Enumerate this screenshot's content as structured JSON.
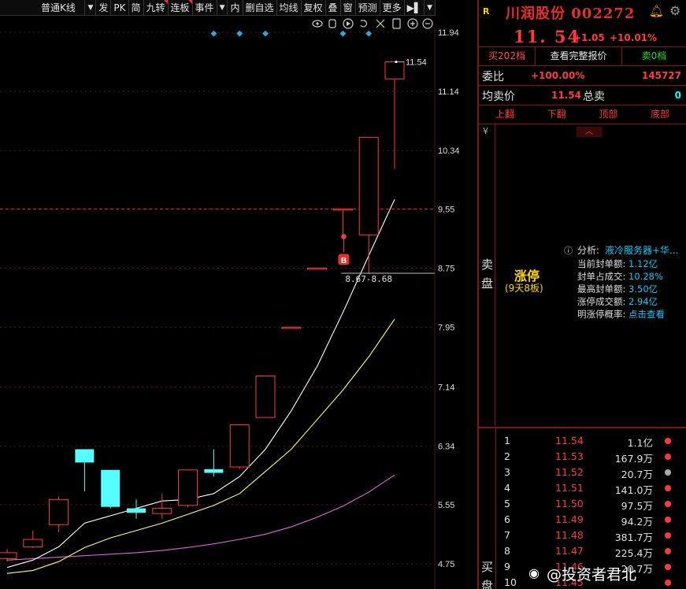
{
  "toolbar": {
    "items": [
      "普通K线",
      "▼",
      "发",
      "PK",
      "简",
      "九转",
      "连板",
      "事件",
      "▼",
      "内",
      "删自选",
      "均线",
      "复权",
      "叠",
      "窗",
      "预测",
      "更多",
      "▶▌",
      "▼"
    ]
  },
  "chart": {
    "price_axis": [
      "11.94",
      "11.14",
      "10.34",
      "9.55",
      "8.75",
      "7.95",
      "7.14",
      "6.34",
      "5.55",
      "4.75"
    ],
    "limit_up_label": "11.54",
    "gap_label": "8.67-8.68",
    "buy_marker": "B",
    "ma_colors": {
      "ma5": "#ffffff",
      "ma10": "#ffff66",
      "ma20": "#dd66dd"
    },
    "up_color": "#ff3b3b",
    "down_color": "#55ffff",
    "candles": [
      {
        "o": 4.82,
        "c": 4.9,
        "h": 4.95,
        "l": 4.78
      },
      {
        "o": 4.98,
        "c": 5.08,
        "h": 5.2,
        "l": 4.96
      },
      {
        "o": 5.28,
        "c": 5.62,
        "h": 5.66,
        "l": 5.18
      },
      {
        "o": 6.3,
        "c": 6.12,
        "h": 6.3,
        "l": 5.73
      },
      {
        "o": 6.02,
        "c": 5.52,
        "h": 6.02,
        "l": 5.5
      },
      {
        "o": 5.5,
        "c": 5.44,
        "h": 5.62,
        "l": 5.36
      },
      {
        "o": 5.43,
        "c": 5.5,
        "h": 5.7,
        "l": 5.36
      },
      {
        "o": 5.54,
        "c": 6.02,
        "h": 6.02,
        "l": 5.52
      },
      {
        "o": 6.03,
        "c": 5.98,
        "h": 6.3,
        "l": 5.93
      },
      {
        "o": 6.06,
        "c": 6.63,
        "h": 6.63,
        "l": 6.03
      },
      {
        "o": 6.73,
        "c": 7.29,
        "h": 7.29,
        "l": 6.73
      },
      {
        "o": 7.95,
        "c": 7.95,
        "h": 7.95,
        "l": 7.95
      },
      {
        "o": 8.75,
        "c": 8.75,
        "h": 8.75,
        "l": 8.75
      },
      {
        "o": 9.55,
        "c": 9.55,
        "h": 9.55,
        "l": 9.2
      },
      {
        "o": 9.2,
        "c": 10.52,
        "h": 10.52,
        "l": 8.67
      },
      {
        "o": 11.31,
        "c": 11.54,
        "h": 11.54,
        "l": 10.09
      }
    ],
    "ma5": [
      4.7,
      4.8,
      4.98,
      5.3,
      5.4,
      5.5,
      5.6,
      5.62,
      5.7,
      5.93,
      6.3,
      6.82,
      7.42,
      8.15,
      8.92,
      9.68
    ],
    "ma10": [
      4.62,
      4.66,
      4.78,
      4.97,
      5.1,
      5.2,
      5.3,
      5.42,
      5.54,
      5.7,
      6.0,
      6.3,
      6.7,
      7.1,
      7.55,
      8.06
    ],
    "ma20": [
      4.8,
      4.82,
      4.84,
      4.86,
      4.88,
      4.9,
      4.93,
      4.97,
      5.02,
      5.08,
      5.15,
      5.25,
      5.38,
      5.53,
      5.72,
      5.95
    ]
  },
  "header": {
    "r_mark": "R",
    "stock_name": "川润股份 002272",
    "last_price": "11. 54",
    "change": "+1.05",
    "change_pct": "+10.01%"
  },
  "tabs": {
    "buy": "买202档",
    "quote": "查看完整报价",
    "sell": "卖0档"
  },
  "stats": {
    "wb_label": "委比",
    "wb_pct": "+100.00%",
    "wb_value": "145727",
    "avg_label": "均卖价",
    "avg_value": "11.54",
    "total_label": "总卖",
    "total_value": "0"
  },
  "nav": [
    "上翻",
    "下翻",
    "顶部",
    "底部"
  ],
  "sell_panel": {
    "yen": "¥",
    "vertical_label": "卖盘",
    "chevron": "︿",
    "limit_title": "涨停",
    "limit_sub": "(9天8板)",
    "analysis_label": "分析:",
    "analysis_value": "液冷服务器+华...",
    "rows": [
      {
        "k": "当前封单额:",
        "v": "1.12亿"
      },
      {
        "k": "封单占成交:",
        "v": "10.28%"
      },
      {
        "k": "最高封单额:",
        "v": "3.50亿"
      },
      {
        "k": "涨停成交额:",
        "v": "2.94亿"
      },
      {
        "k": "明涨停概率:",
        "v": "点击查看"
      }
    ]
  },
  "order_book": {
    "vertical_label": "买盘",
    "rows": [
      {
        "lv": "1",
        "px": "11.54",
        "vol": "1.1亿",
        "dot": "red"
      },
      {
        "lv": "2",
        "px": "11.53",
        "vol": "167.9万",
        "dot": "red"
      },
      {
        "lv": "3",
        "px": "11.52",
        "vol": "20.7万",
        "dot": "grey"
      },
      {
        "lv": "4",
        "px": "11.51",
        "vol": "141.0万",
        "dot": "red"
      },
      {
        "lv": "5",
        "px": "11.50",
        "vol": "97.5万",
        "dot": "red"
      },
      {
        "lv": "6",
        "px": "11.49",
        "vol": "94.2万",
        "dot": "red"
      },
      {
        "lv": "7",
        "px": "11.48",
        "vol": "381.7万",
        "dot": "red"
      },
      {
        "lv": "8",
        "px": "11.47",
        "vol": "225.4万",
        "dot": "red"
      },
      {
        "lv": "9",
        "px": "11.46",
        "vol": "20.7万",
        "dot": "red"
      },
      {
        "lv": "10",
        "px": "11.45",
        "vol": "",
        "dot": "red"
      }
    ]
  },
  "watermark": "@投资者君北"
}
